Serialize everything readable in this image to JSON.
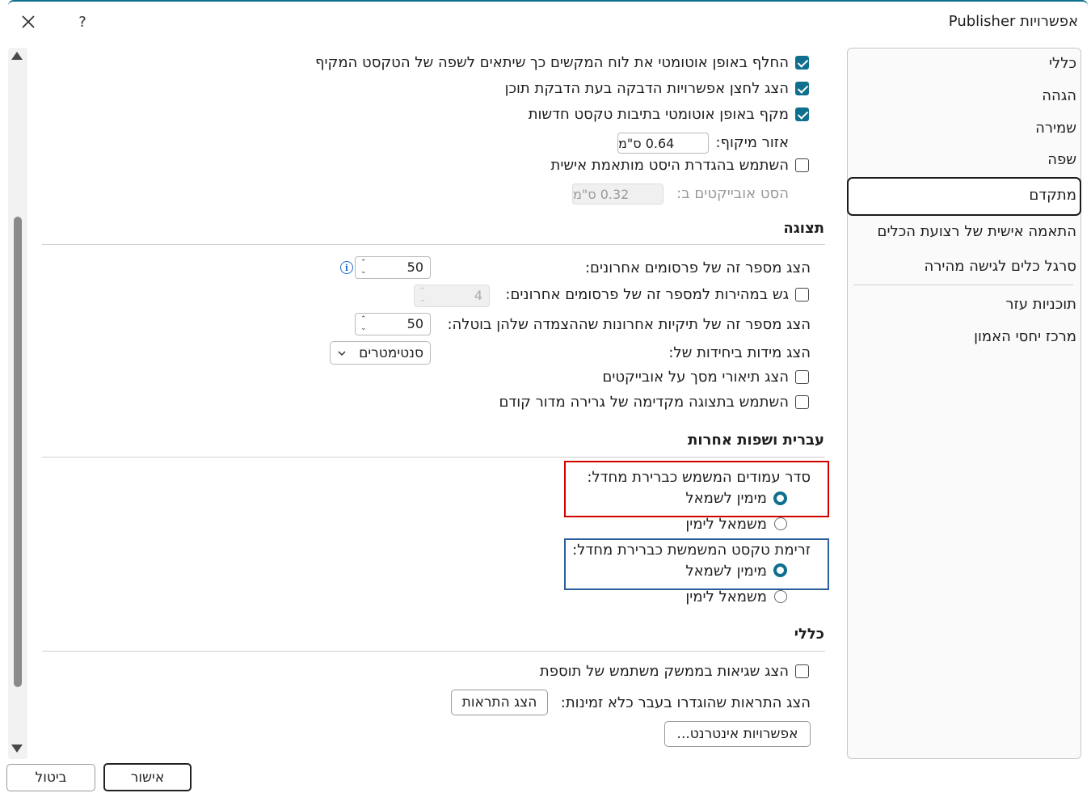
{
  "window": {
    "title": "אפשרויות Publisher",
    "help_label": "?"
  },
  "nav": {
    "items": [
      {
        "label": "כללי"
      },
      {
        "label": "הגהה"
      },
      {
        "label": "שמירה"
      },
      {
        "label": "שפה"
      },
      {
        "label": "מתקדם",
        "selected": true
      },
      {
        "label": "התאמה אישית של רצועת הכלים"
      },
      {
        "label": "סרגל כלים לגישה מהירה"
      },
      {
        "label": "תוכניות עזר"
      },
      {
        "label": "מרכז יחסי האמון"
      }
    ]
  },
  "editing": {
    "auto_keyboard": {
      "label": "החלף באופן אוטומטי את לוח המקשים כך שיתאים לשפה של הטקסט המקיף",
      "checked": true
    },
    "paste_options": {
      "label": "הצג לחצן אפשרויות הדבקה בעת הדבקת תוכן",
      "checked": true
    },
    "auto_hyphenate": {
      "label": "מקף באופן אוטומטי בתיבות טקסט חדשות",
      "checked": true
    },
    "hyphen_zone": {
      "label": "אזור מיקוף:",
      "value": "0.64 ס\"מ"
    },
    "custom_nudge": {
      "label": "השתמש בהגדרת היסט מותאמת אישית",
      "checked": false
    },
    "nudge_by": {
      "label": "הסט אובייקטים ב:",
      "value": "0.32 ס\"מ",
      "disabled": true
    }
  },
  "display": {
    "header": "תצוגה",
    "recent_pubs": {
      "label": "הצג מספר זה של פרסומים אחרונים:",
      "value": "50"
    },
    "quick_access": {
      "label": "גש במהירות למספר זה של פרסומים אחרונים:",
      "value": "4",
      "checked": false,
      "disabled": true
    },
    "recent_folders": {
      "label": "הצג מספר זה של תיקיות אחרונות שההצמדה שלהן בוטלה:",
      "value": "50"
    },
    "units": {
      "label": "הצג מידות ביחידות של:",
      "value": "סנטימטרים"
    },
    "screentips": {
      "label": "הצג תיאורי מסך על אובייקטים",
      "checked": false
    },
    "drag_preview": {
      "label": "השתמש בתצוגה מקדימה של גרירה מדור קודם",
      "checked": false
    }
  },
  "rtl": {
    "header": "עברית ושפות אחרות",
    "page_order": {
      "label": "סדר עמודים המשמש כברירת מחדל:",
      "options": [
        "מימין לשמאל",
        "משמאל לימין"
      ],
      "selected": 0
    },
    "text_flow": {
      "label": "זרימת טקסט המשמשת כברירת מחדל:",
      "options": [
        "מימין לשמאל",
        "משמאל לימין"
      ],
      "selected": 0
    }
  },
  "general": {
    "header": "כללי",
    "addin_errors": {
      "label": "הצג שגיאות בממשק משתמש של תוספת",
      "checked": false
    },
    "alerts": {
      "label": "הצג התראות שהוגדרו בעבר כלא זמינות:",
      "button": "הצג התראות"
    },
    "web_options_button": "אפשרויות אינטרנט..."
  },
  "footer": {
    "ok": "אישור",
    "cancel": "ביטול"
  },
  "colors": {
    "accent": "#0f6f8f",
    "highlight_red": "#d40000",
    "highlight_blue": "#2a5f9a"
  }
}
